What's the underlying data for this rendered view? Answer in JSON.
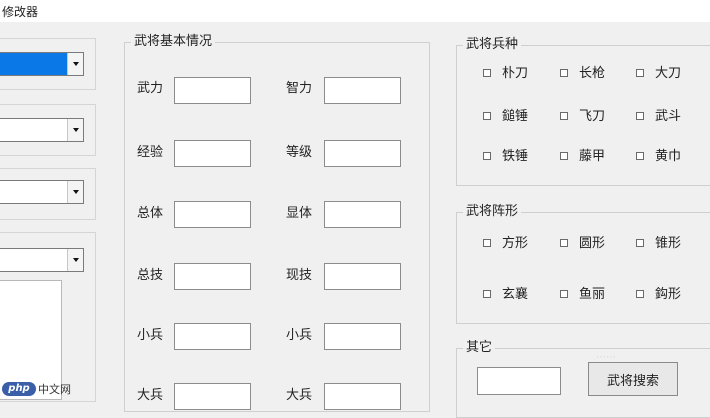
{
  "window": {
    "title": "修改器"
  },
  "basic_info": {
    "legend": "武将基本情况",
    "fields": [
      {
        "label": "武力",
        "value": ""
      },
      {
        "label": "智力",
        "value": ""
      },
      {
        "label": "经验",
        "value": ""
      },
      {
        "label": "等级",
        "value": ""
      },
      {
        "label": "总体",
        "value": ""
      },
      {
        "label": "显体",
        "value": ""
      },
      {
        "label": "总技",
        "value": ""
      },
      {
        "label": "现技",
        "value": ""
      },
      {
        "label": "小兵",
        "value": ""
      },
      {
        "label": "小兵",
        "value": ""
      },
      {
        "label": "大兵",
        "value": ""
      },
      {
        "label": "大兵",
        "value": ""
      }
    ]
  },
  "troops": {
    "legend": "武将兵种",
    "options": [
      "朴刀",
      "长枪",
      "大刀",
      "鎚锤",
      "飞刀",
      "武斗",
      "铁锤",
      "藤甲",
      "黄巾"
    ]
  },
  "formation": {
    "legend": "武将阵形",
    "options": [
      "方形",
      "圆形",
      "锥形",
      "玄襄",
      "鱼丽",
      "鈎形"
    ]
  },
  "other": {
    "legend": "其它",
    "input_value": "",
    "search_button": "武将搜索"
  },
  "watermark": {
    "logo": "php",
    "text": "中文网"
  },
  "colors": {
    "selection": "#0a78e6",
    "background": "#f0f0f0"
  }
}
